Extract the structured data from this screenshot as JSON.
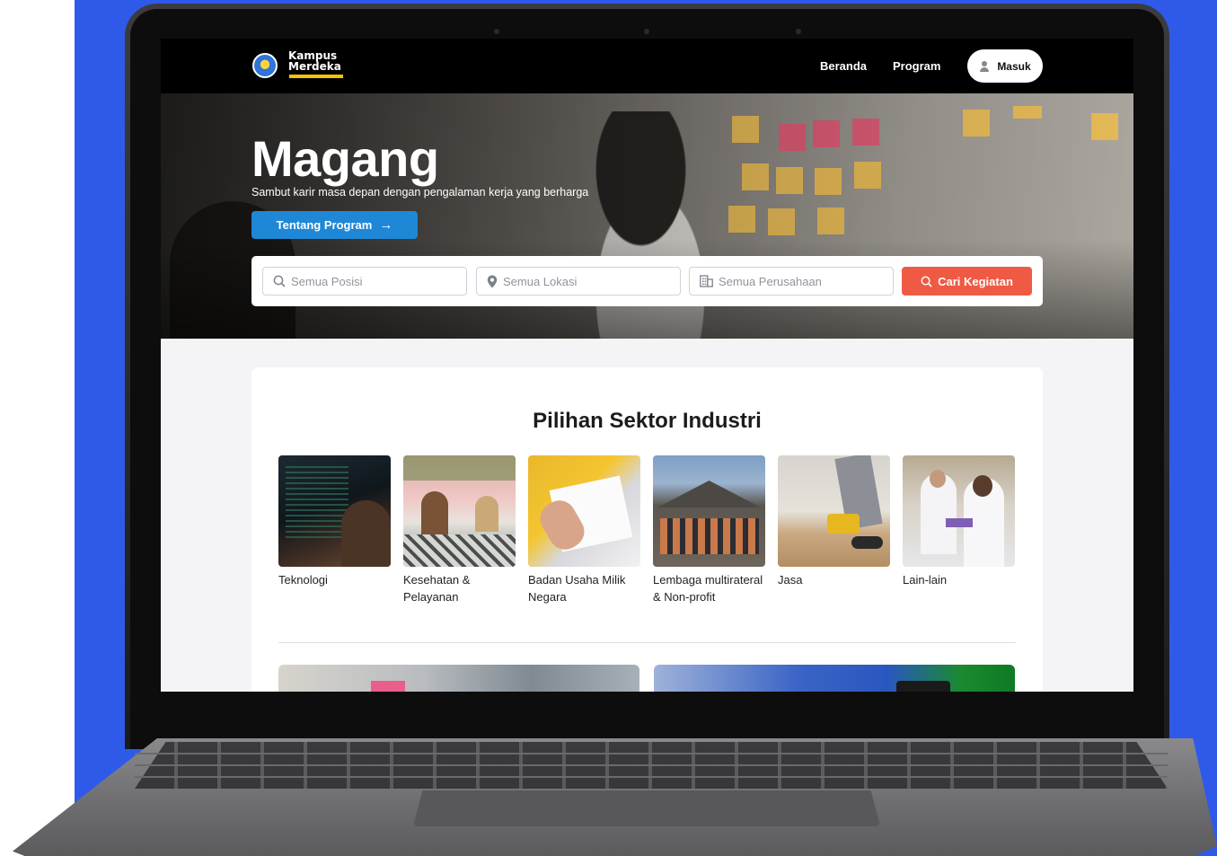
{
  "navbar": {
    "logo_line1": "Kampus",
    "logo_line2": "Merdeka",
    "links": [
      "Beranda",
      "Program"
    ],
    "login_label": "Masuk"
  },
  "hero": {
    "title": "Magang",
    "subtitle": "Sambut karir masa depan dengan pengalaman kerja yang berharga",
    "cta_label": "Tentang Program",
    "cta_arrow": "→"
  },
  "search": {
    "position_placeholder": "Semua Posisi",
    "location_placeholder": "Semua Lokasi",
    "company_placeholder": "Semua Perusahaan",
    "button_label": "Cari Kegiatan"
  },
  "sectors": {
    "title": "Pilihan Sektor Industri",
    "items": [
      {
        "label": "Teknologi"
      },
      {
        "label": "Kesehatan & Pelayanan"
      },
      {
        "label": "Badan Usaha Milik Negara"
      },
      {
        "label": "Lembaga multirateral & Non-profit"
      },
      {
        "label": "Jasa"
      },
      {
        "label": "Lain-lain"
      }
    ]
  },
  "colors": {
    "accent_blue": "#1e88d7",
    "search_button": "#ef5a44",
    "background": "#2f5ae9"
  }
}
